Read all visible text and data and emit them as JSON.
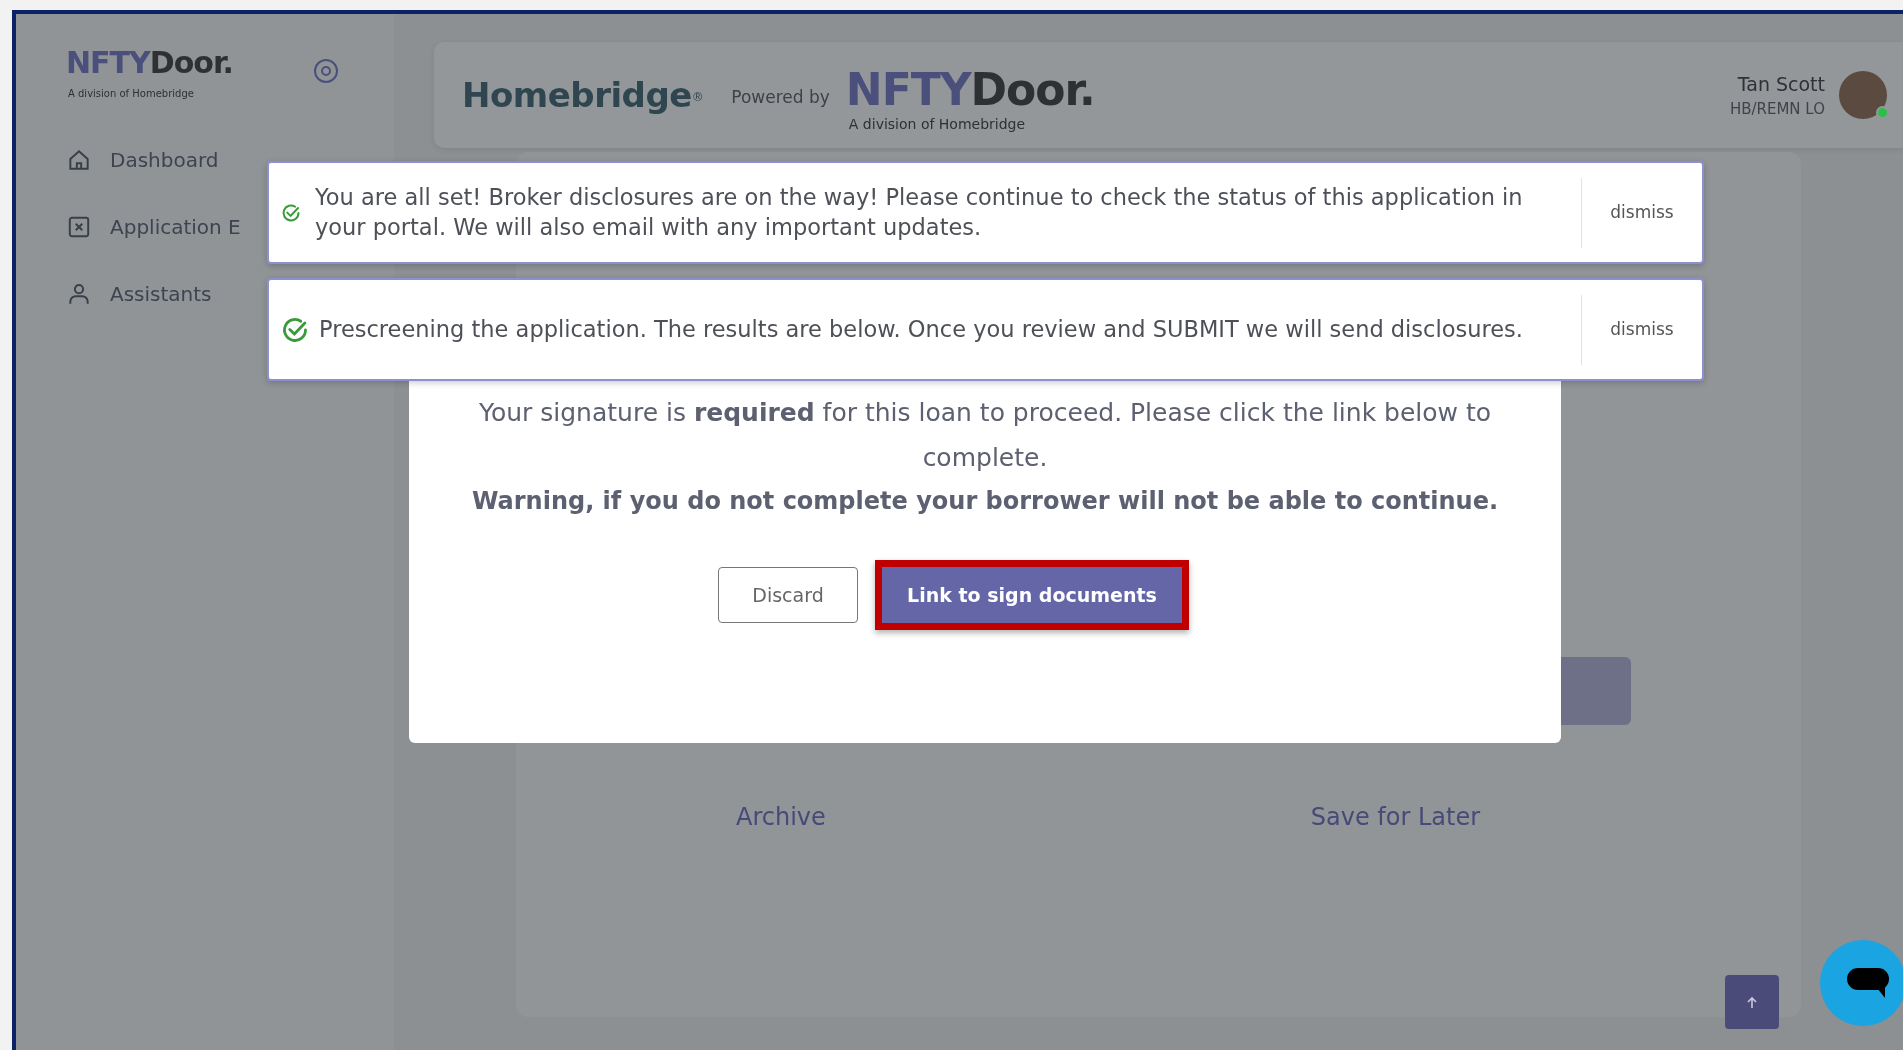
{
  "sidebar": {
    "logo": {
      "primary": "NFTY",
      "secondary": "Door.",
      "tagline": "A division of Homebridge"
    },
    "items": [
      {
        "label": "Dashboard",
        "kind": "home"
      },
      {
        "label": "Application E",
        "kind": "close"
      },
      {
        "label": "Assistants",
        "kind": "person"
      }
    ]
  },
  "header": {
    "partner_logo": "Homebridge$^{®}$",
    "powered_by": "Powered by",
    "logo": {
      "primary": "NFTY",
      "secondary": "Door.",
      "tagline": "A division of Homebridge"
    },
    "user": {
      "name": "Tan Scott",
      "role": "HB/REMN LO",
      "online": true
    }
  },
  "toasts": [
    {
      "text": "You are all set! Broker disclosures are on the way! Please continue to check the status of this application in your portal. We will also email with any important updates.",
      "action": "dismiss"
    },
    {
      "text": "Prescreening the application. The results are below. Once you review and SUBMIT we will send disclosures.",
      "action": "dismiss"
    }
  ],
  "modal": {
    "message": "Your signature is **required** for this loan to proceed. Please click the link below to complete.",
    "warning": "Warning, if you do not complete your borrower will not be able to continue.",
    "buttons": [
      {
        "label": "Discard",
        "kind": "outline",
        "highlighted": false
      },
      {
        "label": "Link to sign documents",
        "kind": "primary",
        "highlighted": true
      }
    ]
  },
  "page_actions": [
    "Archive",
    "Save for Later"
  ]
}
